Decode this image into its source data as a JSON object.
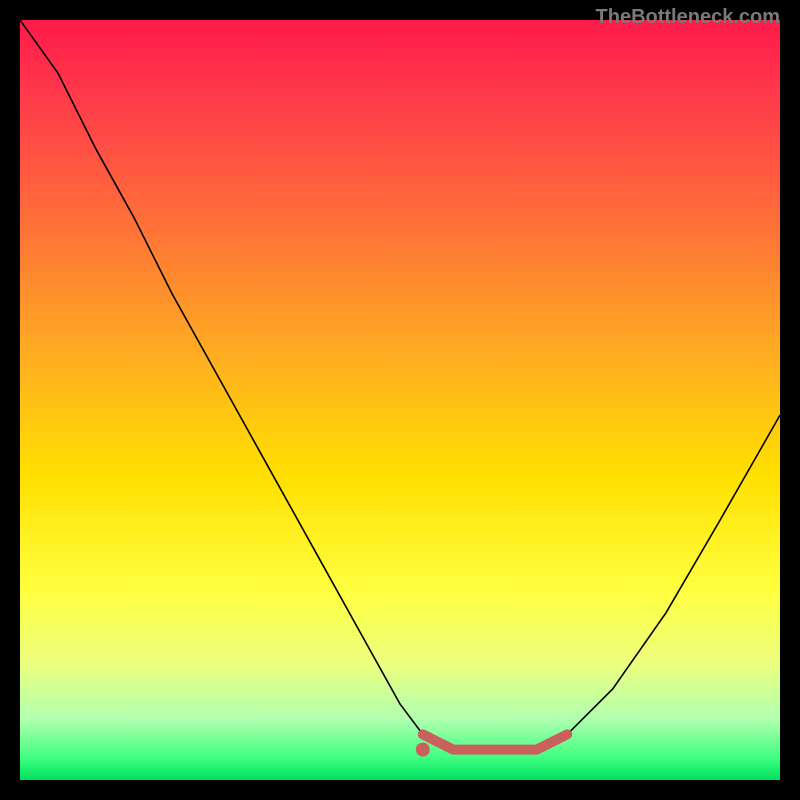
{
  "attribution": "TheBottleneck.com",
  "chart_data": {
    "type": "line",
    "title": "",
    "xlabel": "",
    "ylabel": "",
    "xlim": [
      0,
      100
    ],
    "ylim": [
      0,
      100
    ],
    "series": [
      {
        "name": "bottleneck-curve",
        "x": [
          0,
          5,
          10,
          15,
          20,
          25,
          30,
          35,
          40,
          45,
          50,
          53,
          57,
          63,
          68,
          72,
          78,
          85,
          92,
          100
        ],
        "values": [
          100,
          93,
          83,
          74,
          64,
          55,
          46,
          37,
          28,
          19,
          10,
          6,
          4,
          4,
          4,
          6,
          12,
          22,
          34,
          48
        ]
      }
    ],
    "highlight_region": {
      "x_start": 53,
      "x_end": 72,
      "y": 4,
      "dot_x": 53,
      "dot_y": 4
    },
    "colors": {
      "gradient_top": "#ff1a4a",
      "gradient_bottom": "#00e060",
      "curve": "#000000",
      "highlight": "#c9605b"
    }
  }
}
